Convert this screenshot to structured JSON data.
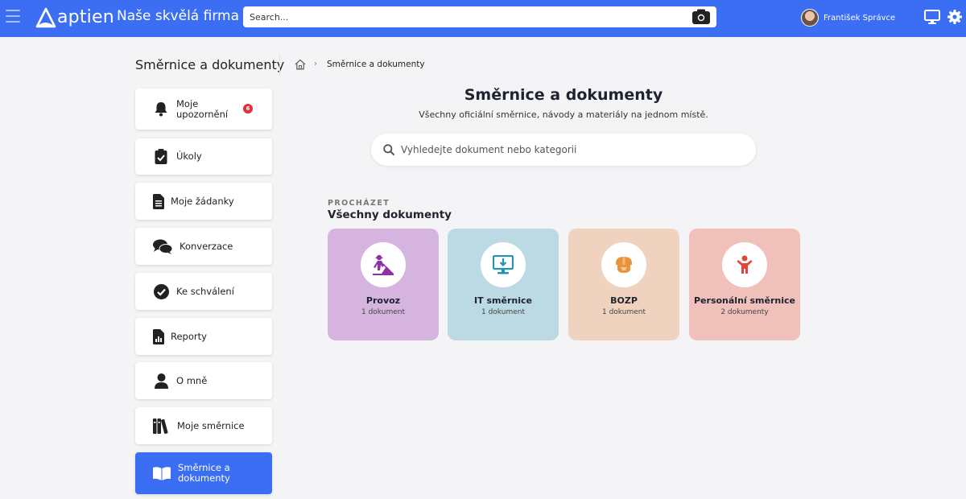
{
  "topbar": {
    "logo_text": "aptien",
    "company": "Naše skvělá firma",
    "search_placeholder": "Search...",
    "user_name": "František Správce"
  },
  "sidebar": {
    "title": "Směrnice a dokumenty",
    "items": [
      {
        "label": "Moje upozornění",
        "icon": "bell-icon",
        "badge": "6"
      },
      {
        "label": "Úkoly",
        "icon": "clipboard-check-icon"
      },
      {
        "label": "Moje žádanky",
        "icon": "document-icon"
      },
      {
        "label": "Konverzace",
        "icon": "chat-bubbles-icon"
      },
      {
        "label": "Ke schválení",
        "icon": "check-circle-icon"
      },
      {
        "label": "Reporty",
        "icon": "report-icon"
      },
      {
        "label": "O mně",
        "icon": "user-icon"
      },
      {
        "label": "Moje směrnice",
        "icon": "books-icon"
      },
      {
        "label": "Směrnice a dokumenty",
        "icon": "open-book-icon",
        "active": true
      }
    ]
  },
  "breadcrumb": {
    "separator": "›",
    "current": "Směrnice a dokumenty"
  },
  "main": {
    "title": "Směrnice a dokumenty",
    "subtitle": "Všechny oficiální směrnice, návody a materiály na jednom místě.",
    "search_placeholder": "Vyhledejte dokument nebo kategorii",
    "browse_eyebrow": "PROCHÁZET",
    "browse_title": "Všechny dokumenty",
    "categories": [
      {
        "name": "Provoz",
        "count": "1 dokument",
        "bg": "#d5b4e0",
        "accent": "#8e2fa6",
        "icon": "road-worker-icon"
      },
      {
        "name": "IT směrnice",
        "count": "1 dokument",
        "bg": "#bcdae4",
        "accent": "#2492b4",
        "icon": "monitor-download-icon"
      },
      {
        "name": "BOZP",
        "count": "1 dokument",
        "bg": "#f0d3bf",
        "accent": "#e8943d",
        "icon": "hard-hat-icon"
      },
      {
        "name": "Personální směrnice",
        "count": "2 dokumenty",
        "bg": "#f0c0bb",
        "accent": "#e0463c",
        "icon": "person-icon"
      }
    ]
  },
  "colors": {
    "brand": "#3b6ef2",
    "badge": "#e0303e",
    "background": "#f4f4f6"
  }
}
